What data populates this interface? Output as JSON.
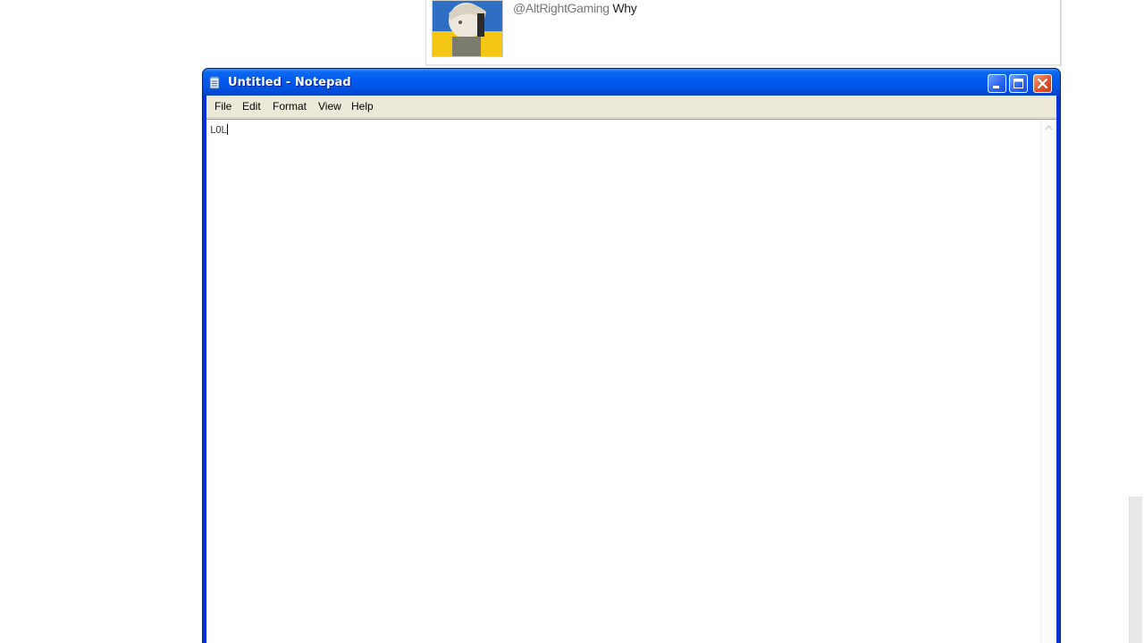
{
  "background": {
    "comment": {
      "handle": "@AltRightGaming",
      "text": "Why"
    }
  },
  "notepad": {
    "title": "Untitled - Notepad",
    "menu": [
      "File",
      "Edit",
      "Format",
      "View",
      "Help"
    ],
    "content": "LOL"
  },
  "colors": {
    "titlebar": "#0058ee",
    "frame": "#0831d9",
    "close_button": "#e2532a",
    "menubar": "#ece9d8"
  },
  "icons": [
    "notepad-icon",
    "minimize-icon",
    "maximize-icon",
    "close-icon",
    "scroll-up-icon",
    "scroll-down-icon"
  ]
}
